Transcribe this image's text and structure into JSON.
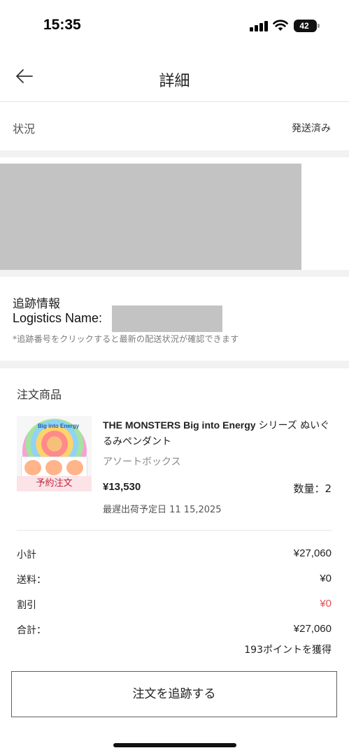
{
  "statusbar": {
    "time": "15:35",
    "battery": "42"
  },
  "nav": {
    "title": "詳細",
    "back_icon": "arrow-left-icon"
  },
  "status": {
    "label": "状況",
    "value": "発送済み"
  },
  "tracking": {
    "heading": "追跡情報",
    "logistics_label": "Logistics Name:",
    "note": "*追跡番号をクリックすると最新の配送状況が確認できます"
  },
  "order": {
    "heading": "注文商品",
    "product": {
      "title_en": "THE MONSTERS Big into Energy",
      "title_jp": "シリーズ ぬいぐるみペンダント",
      "variant": "アソートボックス",
      "badge": "予約注文",
      "image_text": "Big into Energy",
      "price": "¥13,530",
      "quantity": "数量：2",
      "ship_date": "最遅出荷予定日 11 15,2025"
    },
    "summary": {
      "subtotal_label": "小計",
      "subtotal_value": "¥27,060",
      "shipping_label": "送料：",
      "shipping_value": "¥0",
      "discount_label": "割引",
      "discount_value": "¥0",
      "total_label": "合計：",
      "total_value": "¥27,060",
      "points": "193ポイントを獲得"
    }
  },
  "actions": {
    "track_button": "注文を追跡する"
  },
  "colors": {
    "discount_red": "#e05252",
    "badge_bg": "#fbe3e7",
    "badge_text": "#c2263b",
    "redaction": "#c3c3c3"
  }
}
